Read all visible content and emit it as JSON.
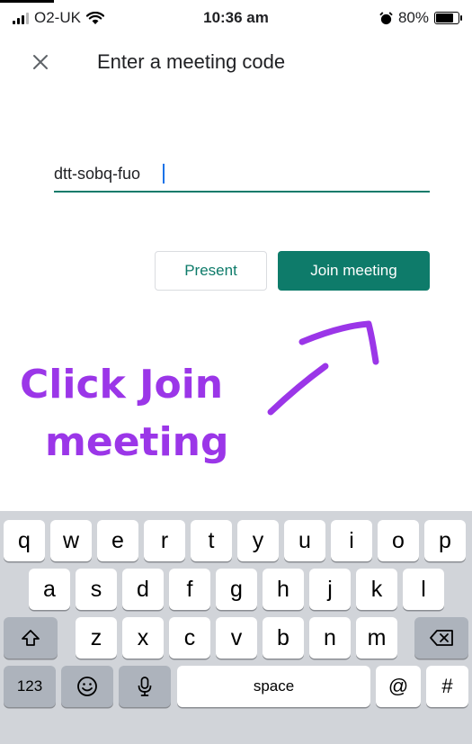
{
  "status_bar": {
    "carrier": "O2-UK",
    "time": "10:36 am",
    "battery": "80%",
    "battery_level": 0.8
  },
  "header": {
    "title": "Enter a meeting code"
  },
  "meeting_code": {
    "value": "dtt-sobq-fuo"
  },
  "buttons": {
    "present": "Present",
    "join": "Join meeting"
  },
  "annotation": {
    "line1": "Click Join",
    "line2": "meeting",
    "color": "#9b36e8"
  },
  "keyboard": {
    "row1": [
      "q",
      "w",
      "e",
      "r",
      "t",
      "y",
      "u",
      "i",
      "o",
      "p"
    ],
    "row2": [
      "a",
      "s",
      "d",
      "f",
      "g",
      "h",
      "j",
      "k",
      "l"
    ],
    "row3": [
      "z",
      "x",
      "c",
      "v",
      "b",
      "n",
      "m"
    ],
    "numbers_key": "123",
    "space_key": "space",
    "at_key": "@",
    "hash_key": "#"
  },
  "colors": {
    "accent": "#0e7b6a",
    "keyboard_bg": "#d1d4d9"
  }
}
